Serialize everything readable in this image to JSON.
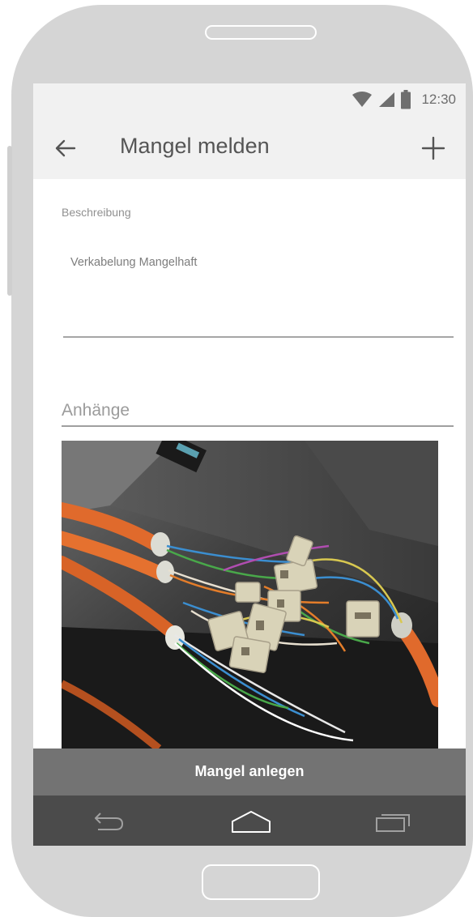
{
  "status_bar": {
    "time": "12:30",
    "icons": [
      "wifi-icon",
      "signal-icon",
      "battery-icon"
    ]
  },
  "toolbar": {
    "title": "Mangel melden",
    "back_icon": "arrow-left-icon",
    "add_icon": "plus-icon"
  },
  "form": {
    "description_label": "Beschreibung",
    "description_value": "Verkabelung Mangelhaft",
    "attachments_label": "Anhänge"
  },
  "attachment": {
    "image_subject": "orange network cables with beige connectors"
  },
  "action": {
    "submit_label": "Mangel anlegen"
  },
  "nav": {
    "back_icon": "back-icon",
    "home_icon": "home-icon",
    "recents_icon": "recents-icon"
  },
  "colors": {
    "toolbar_bg": "#f1f1f1",
    "action_bar_bg": "#737373",
    "nav_bar_bg": "#4b4b4b",
    "phone_frame": "#d5d5d5"
  }
}
